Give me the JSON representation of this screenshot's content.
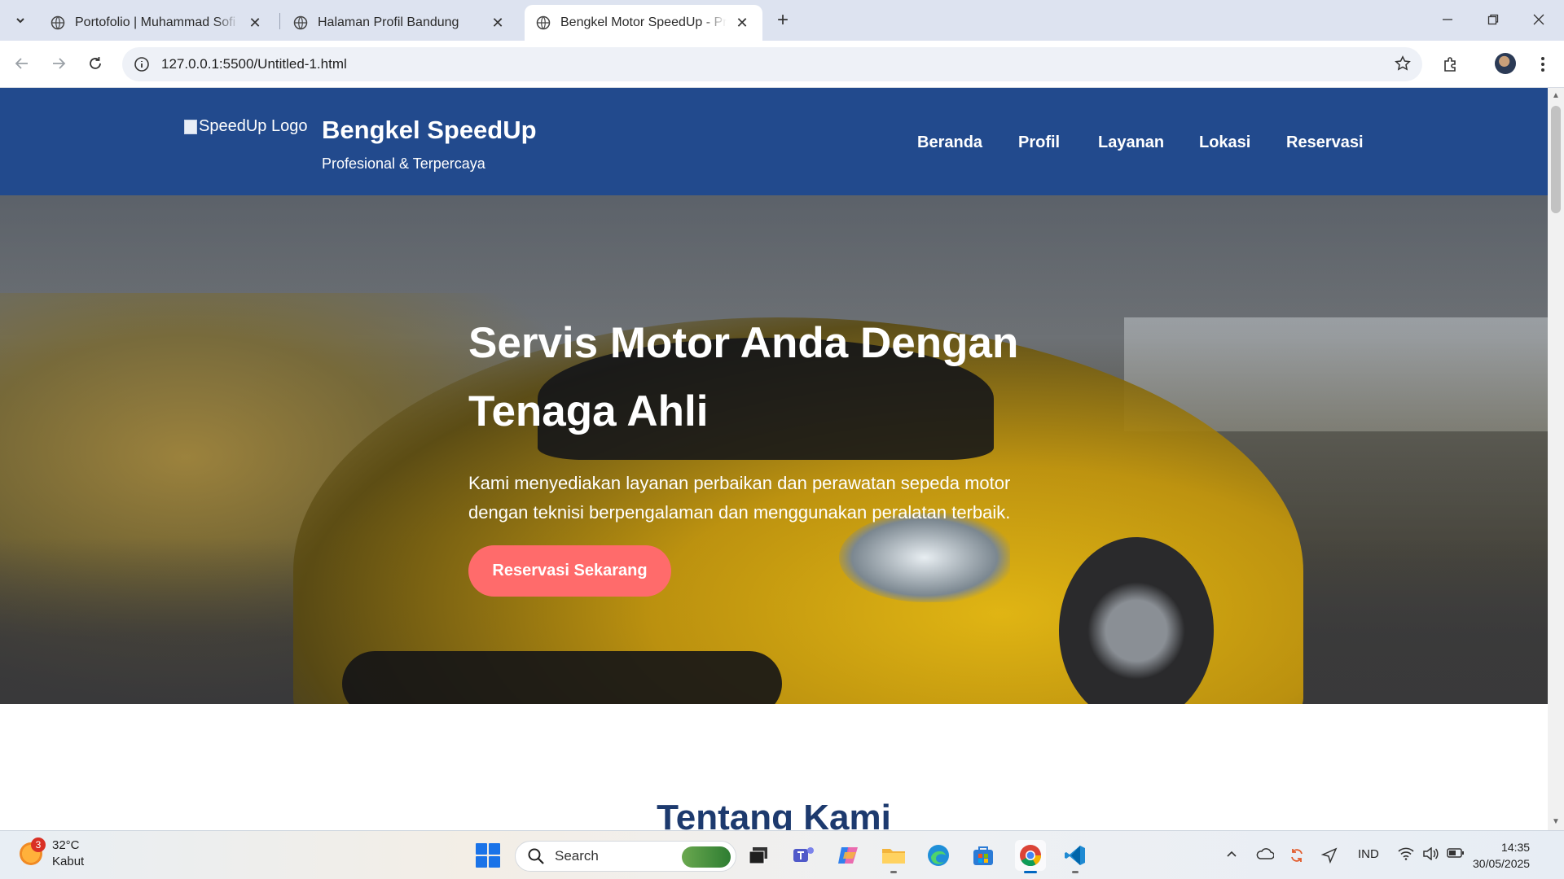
{
  "browser": {
    "tabs": [
      {
        "title": "Portofolio | Muhammad Sofi Da",
        "active": false
      },
      {
        "title": "Halaman Profil Bandung",
        "active": false
      },
      {
        "title": "Bengkel Motor SpeedUp - Profe",
        "active": true
      }
    ],
    "url": "127.0.0.1:5500/Untitled-1.html"
  },
  "site": {
    "logo_alt": "SpeedUp Logo",
    "brand_name": "Bengkel SpeedUp",
    "tagline": "Profesional & Terpercaya",
    "nav": [
      "Beranda",
      "Profil",
      "Layanan",
      "Lokasi",
      "Reservasi"
    ],
    "hero": {
      "title_line1": "Servis Motor Anda Dengan",
      "title_line2": "Tenaga Ahli",
      "desc_line1": "Kami menyediakan layanan perbaikan dan perawatan sepeda motor",
      "desc_line2": "dengan teknisi berpengalaman dan menggunakan peralatan terbaik.",
      "cta": "Reservasi Sekarang"
    },
    "about_title": "Tentang Kami",
    "colors": {
      "header": "#224a8d",
      "cta": "#ff6b6b",
      "heading": "#1d3a6e"
    }
  },
  "taskbar": {
    "weather": {
      "badge": "3",
      "temp": "32°C",
      "condition": "Kabut"
    },
    "search_label": "Search",
    "apps": [
      "start-icon",
      "task-view-icon",
      "teams-icon",
      "copilot-icon",
      "file-explorer-icon",
      "edge-icon",
      "store-icon",
      "chrome-icon",
      "vscode-icon"
    ],
    "lang": "IND",
    "time": "14:35",
    "date": "30/05/2025"
  }
}
